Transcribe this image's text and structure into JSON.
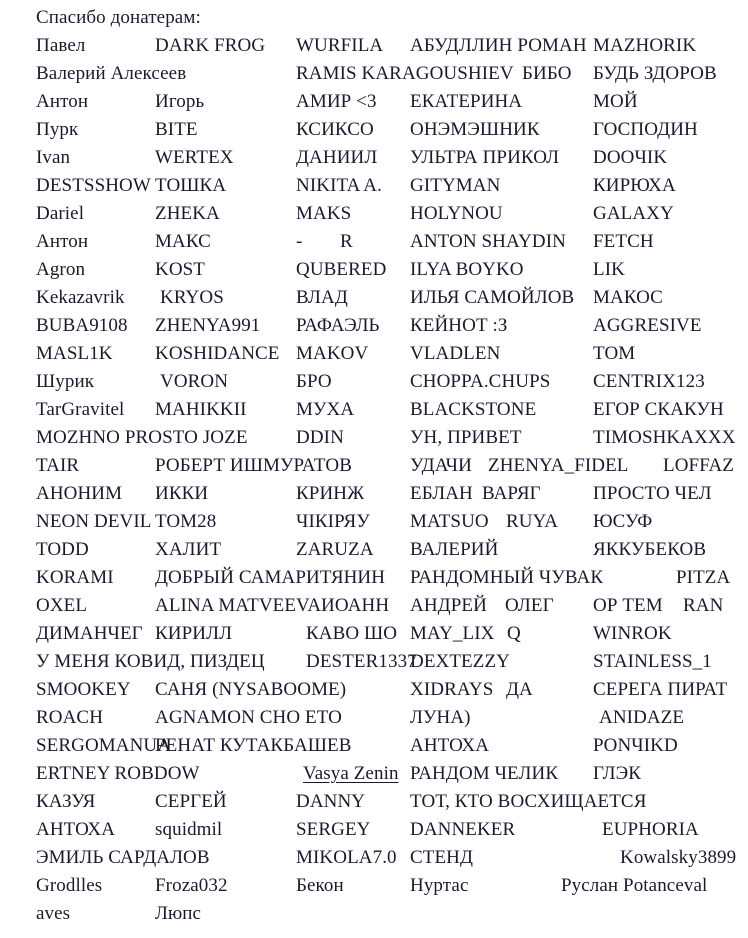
{
  "document": {
    "heading": "Спасибо донатерам:",
    "background_color": "#ffffff",
    "text_color": "#1a1a2e",
    "rows": [
      {
        "cells": [
          {
            "text": "Павел",
            "col": 0
          },
          {
            "text": "DARK FROG",
            "col": 1
          },
          {
            "text": "WURFILA",
            "col": 2
          },
          {
            "text": "АБУДЛЛИН РОМАН",
            "col": 3
          },
          {
            "text": "MAZHORIK",
            "col": 4
          }
        ]
      },
      {
        "cells": [
          {
            "text": "Валерий Алексеев",
            "col": 0
          },
          {
            "text": "RAMIS KARAGOUSHIEV",
            "col": 2
          },
          {
            "text": "БИБО",
            "col": 3,
            "offset": 112
          },
          {
            "text": "БУДЬ ЗДОРОВ",
            "col": 4
          }
        ]
      },
      {
        "cells": [
          {
            "text": "Антон",
            "col": 0
          },
          {
            "text": "Игорь",
            "col": 1
          },
          {
            "text": "АМИР <3",
            "col": 2
          },
          {
            "text": "ЕКАТЕРИНА",
            "col": 3
          },
          {
            "text": "МОЙ",
            "col": 4
          }
        ]
      },
      {
        "cells": [
          {
            "text": "Пурк",
            "col": 0
          },
          {
            "text": "BITE",
            "col": 1
          },
          {
            "text": "КСИКСО",
            "col": 2
          },
          {
            "text": "ОНЭМЭШНИК",
            "col": 3
          },
          {
            "text": "ГОСПОДИН",
            "col": 4
          }
        ]
      },
      {
        "cells": [
          {
            "text": "Ivan",
            "col": 0
          },
          {
            "text": "WERTEX",
            "col": 1
          },
          {
            "text": "ДАНИИЛ",
            "col": 2
          },
          {
            "text": "УЛЬТРА ПРИКОЛ",
            "col": 3
          },
          {
            "text": "DOOЧIK",
            "col": 4
          }
        ]
      },
      {
        "cells": [
          {
            "text": "DESTSSHOW",
            "col": 0
          },
          {
            "text": "ТОШКА",
            "col": 1
          },
          {
            "text": "NIKITA A.",
            "col": 2
          },
          {
            "text": "GITYMAN",
            "col": 3
          },
          {
            "text": "КИРЮХА",
            "col": 4
          }
        ]
      },
      {
        "cells": [
          {
            "text": "Dariel",
            "col": 0
          },
          {
            "text": "ZHEKA",
            "col": 1
          },
          {
            "text": "MAKS",
            "col": 2
          },
          {
            "text": "HOLYNOU",
            "col": 3
          },
          {
            "text": "GALAXY",
            "col": 4
          }
        ]
      },
      {
        "cells": [
          {
            "text": "Антон",
            "col": 0
          },
          {
            "text": "МАКС",
            "col": 1
          },
          {
            "text": "-",
            "col": 2
          },
          {
            "text": "R",
            "col": 2,
            "offset": 44
          },
          {
            "text": "ANTON SHAYDIN",
            "col": 3
          },
          {
            "text": "FETCH",
            "col": 4
          }
        ]
      },
      {
        "cells": [
          {
            "text": "Agron",
            "col": 0
          },
          {
            "text": "KOST",
            "col": 1
          },
          {
            "text": "QUBERED",
            "col": 2
          },
          {
            "text": "ILYA BOYKO",
            "col": 3
          },
          {
            "text": "LIK",
            "col": 4
          }
        ]
      },
      {
        "cells": [
          {
            "text": "Kekazavrik",
            "col": 0
          },
          {
            "text": "KRYOS",
            "col": 1,
            "offset": 5
          },
          {
            "text": "ВЛАД",
            "col": 2
          },
          {
            "text": "ИЛЬЯ САМОЙЛОВ",
            "col": 3
          },
          {
            "text": "МАКОС",
            "col": 4
          }
        ]
      },
      {
        "cells": [
          {
            "text": "BUBA9108",
            "col": 0
          },
          {
            "text": "ZHENYA991",
            "col": 1
          },
          {
            "text": "РАФАЭЛЬ",
            "col": 2
          },
          {
            "text": "КЕЙНОТ :З",
            "col": 3
          },
          {
            "text": "AGGRESIVE",
            "col": 4
          }
        ]
      },
      {
        "cells": [
          {
            "text": "MASL1K",
            "col": 0
          },
          {
            "text": "KOSHIDANCE",
            "col": 1
          },
          {
            "text": "MAKOV",
            "col": 2
          },
          {
            "text": "VLADLEN",
            "col": 3
          },
          {
            "text": "ТОМ",
            "col": 4
          }
        ]
      },
      {
        "cells": [
          {
            "text": "Шурик",
            "col": 0
          },
          {
            "text": "VORON",
            "col": 1,
            "offset": 5
          },
          {
            "text": "БРО",
            "col": 2
          },
          {
            "text": "CHOPPA.CHUPS",
            "col": 3
          },
          {
            "text": "CENTRIX123",
            "col": 4
          }
        ]
      },
      {
        "cells": [
          {
            "text": "TarGravitel",
            "col": 0
          },
          {
            "text": "MAHIKKII",
            "col": 1
          },
          {
            "text": "МУХА",
            "col": 2
          },
          {
            "text": "BLACKSTONE",
            "col": 3
          },
          {
            "text": "ЕГОР СКАКУН",
            "col": 4
          }
        ]
      },
      {
        "cells": [
          {
            "text": "MOZHNO PROSTO JOZE",
            "col": 0
          },
          {
            "text": "DDIN",
            "col": 2
          },
          {
            "text": "УН, ПРИВЕТ",
            "col": 3
          },
          {
            "text": "TIMOSHKAXXX",
            "col": 4
          }
        ]
      },
      {
        "cells": [
          {
            "text": "TAIR",
            "col": 0
          },
          {
            "text": "РОБЕРТ ИШМУРАТОВ",
            "col": 1
          },
          {
            "text": "УДАЧИ",
            "col": 3
          },
          {
            "text": "ZHENYA_FIDEL",
            "col": 3,
            "offset": 78
          },
          {
            "text": "LOFFAZ",
            "col": 4,
            "offset": 70
          }
        ]
      },
      {
        "cells": [
          {
            "text": "АНОНИМ",
            "col": 0
          },
          {
            "text": "ИККИ",
            "col": 1
          },
          {
            "text": "КРИНЖ",
            "col": 2
          },
          {
            "text": "ЕБЛАН",
            "col": 3
          },
          {
            "text": "ВАРЯГ",
            "col": 3,
            "offset": 72
          },
          {
            "text": "ПРОСТО ЧЕЛ",
            "col": 4
          }
        ]
      },
      {
        "cells": [
          {
            "text": "NEON DEVIL",
            "col": 0
          },
          {
            "text": "TOM28",
            "col": 1
          },
          {
            "text": "ЧІКІРЯУ",
            "col": 2
          },
          {
            "text": "MATSUO",
            "col": 3
          },
          {
            "text": "RUYA",
            "col": 3,
            "offset": 96
          },
          {
            "text": "ЮСУФ",
            "col": 4
          }
        ]
      },
      {
        "cells": [
          {
            "text": "TODD",
            "col": 0
          },
          {
            "text": "ХАЛИТ",
            "col": 1
          },
          {
            "text": "ZARUZA",
            "col": 2
          },
          {
            "text": "ВАЛЕРИЙ",
            "col": 3
          },
          {
            "text": "ЯККУБЕКОВ",
            "col": 4
          }
        ]
      },
      {
        "cells": [
          {
            "text": "KORAMI",
            "col": 0
          },
          {
            "text": "ДОБРЫЙ САМАРИТЯНИН",
            "col": 1
          },
          {
            "text": "РАНДОМНЫЙ ЧУВАК",
            "col": 3
          },
          {
            "text": "PITZA",
            "col": 4,
            "offset": 83
          }
        ]
      },
      {
        "cells": [
          {
            "text": "OXEL",
            "col": 0
          },
          {
            "text": "ALINA MATVEEVA",
            "col": 1
          },
          {
            "text": "ИОАНН",
            "col": 2,
            "offset": 25
          },
          {
            "text": "АНДРЕЙ",
            "col": 3
          },
          {
            "text": "ОЛЕГ",
            "col": 3,
            "offset": 95
          },
          {
            "text": "ОР ТЕМ",
            "col": 4
          },
          {
            "text": "RAN",
            "col": 4,
            "offset": 90
          }
        ]
      },
      {
        "cells": [
          {
            "text": "ДИМАНЧЕГ",
            "col": 0
          },
          {
            "text": "КИРИЛЛ",
            "col": 1
          },
          {
            "text": "КАВО ШО",
            "col": 2,
            "offset": 10
          },
          {
            "text": "MAY_LIX",
            "col": 3
          },
          {
            "text": "Q",
            "col": 3,
            "offset": 97
          },
          {
            "text": "WINROK",
            "col": 4
          }
        ]
      },
      {
        "cells": [
          {
            "text": "У МЕНЯ КОВИД, ПИЗДЕЦ",
            "col": 0
          },
          {
            "text": "DESTER1337",
            "col": 2,
            "offset": 10
          },
          {
            "text": "DEXTEZZY",
            "col": 3
          },
          {
            "text": "STAINLESS_1",
            "col": 4
          }
        ]
      },
      {
        "cells": [
          {
            "text": "SMOOKEY",
            "col": 0
          },
          {
            "text": "САНЯ (NYSABOOME)",
            "col": 1
          },
          {
            "text": "XIDRAYS",
            "col": 3
          },
          {
            "text": "ДА",
            "col": 3,
            "offset": 96
          },
          {
            "text": "СЕРЕГА ПИРАТ",
            "col": 4
          }
        ]
      },
      {
        "cells": [
          {
            "text": "ROACH",
            "col": 0
          },
          {
            "text": "AGNAMON CHO ETO",
            "col": 1
          },
          {
            "text": "ЛУНА)",
            "col": 3
          },
          {
            "text": "ANIDAZE",
            "col": 4,
            "offset": 6
          }
        ]
      },
      {
        "cells": [
          {
            "text": "SERGOMANUA",
            "col": 0
          },
          {
            "text": "РЕНАТ КУТАКБАШЕВ",
            "col": 1
          },
          {
            "text": "АНТОХА",
            "col": 3
          },
          {
            "text": "PONЧIKD",
            "col": 4
          }
        ]
      },
      {
        "cells": [
          {
            "text": "ERTNEY ROBDOW",
            "col": 0
          },
          {
            "text": "Vasya Zenin",
            "col": 2,
            "offset": 7,
            "underline": true
          },
          {
            "text": "РАНДОМ ЧЕЛИК",
            "col": 3
          },
          {
            "text": "ГЛЭК",
            "col": 4
          }
        ]
      },
      {
        "cells": [
          {
            "text": "КАЗУЯ",
            "col": 0
          },
          {
            "text": "СЕРГЕЙ",
            "col": 1
          },
          {
            "text": "DANNY",
            "col": 2
          },
          {
            "text": "ТОТ, КТО ВОСХИЩАЕТСЯ",
            "col": 3
          }
        ]
      },
      {
        "cells": [
          {
            "text": "АНТОХА",
            "col": 0
          },
          {
            "text": "squidmil",
            "col": 1
          },
          {
            "text": "SERGEY",
            "col": 2
          },
          {
            "text": "DANNEKER",
            "col": 3
          },
          {
            "text": "EUPHORIA",
            "col": 4,
            "offset": 9
          }
        ]
      },
      {
        "cells": [
          {
            "text": "ЭМИЛЬ САРДАЛОВ",
            "col": 0
          },
          {
            "text": "MIKOLA7.0",
            "col": 2
          },
          {
            "text": "СТЕНД",
            "col": 3
          },
          {
            "text": "Kowalsky3899",
            "col": 4,
            "offset": 27
          }
        ]
      },
      {
        "cells": [
          {
            "text": "Grodlles",
            "col": 0
          },
          {
            "text": "Froza032",
            "col": 1
          },
          {
            "text": "Бекон",
            "col": 2
          },
          {
            "text": "Нуртас",
            "col": 3
          },
          {
            "text": "Руслан Potanceval",
            "col": 4,
            "offset": -32
          }
        ]
      },
      {
        "cells": [
          {
            "text": "aves",
            "col": 0
          },
          {
            "text": "Люпс",
            "col": 1
          }
        ]
      }
    ]
  }
}
